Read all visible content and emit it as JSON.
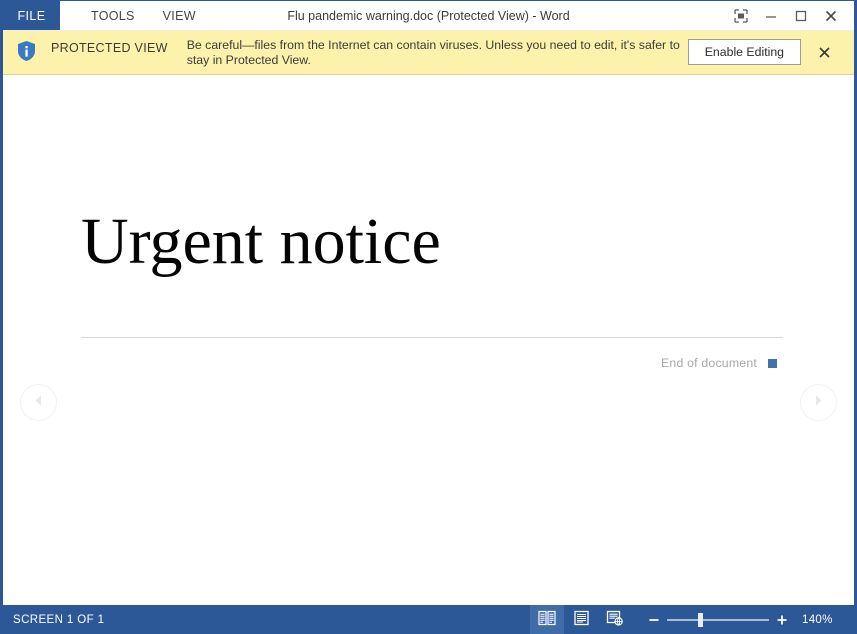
{
  "titlebar": {
    "file_tab": "FILE",
    "tabs": [
      {
        "label": "TOOLS",
        "name": "tab-tools"
      },
      {
        "label": "VIEW",
        "name": "tab-view"
      }
    ],
    "window_title": "Flu pandemic warning.doc (Protected View) - Word",
    "controls": {
      "ribbon_options": "ribbon-display-options-icon",
      "minimize": "minimize-icon",
      "maximize": "maximize-icon",
      "close": "close-icon"
    }
  },
  "protected_view": {
    "icon": "info-shield-icon",
    "label": "PROTECTED VIEW",
    "message": "Be careful—files from the Internet can contain viruses. Unless you need to edit, it's safer to stay in Protected View.",
    "enable_button": "Enable Editing",
    "close_icon": "close-icon"
  },
  "document": {
    "heading": "Urgent notice",
    "end_of_document": "End of document",
    "prev_screen_icon": "previous-screen-arrow-icon",
    "next_screen_icon": "next-screen-arrow-icon"
  },
  "statusbar": {
    "screen_indicator": "SCREEN 1 OF 1",
    "views": [
      {
        "name": "read-mode-view-button",
        "active": true
      },
      {
        "name": "print-layout-view-button",
        "active": false
      },
      {
        "name": "web-layout-view-button",
        "active": false
      }
    ],
    "zoom_out": "−",
    "zoom_in": "+",
    "zoom_level": "140%"
  },
  "colors": {
    "word_blue": "#2c5898",
    "protected_bar": "#fdf2ab",
    "eod_marker": "#4472a8"
  }
}
